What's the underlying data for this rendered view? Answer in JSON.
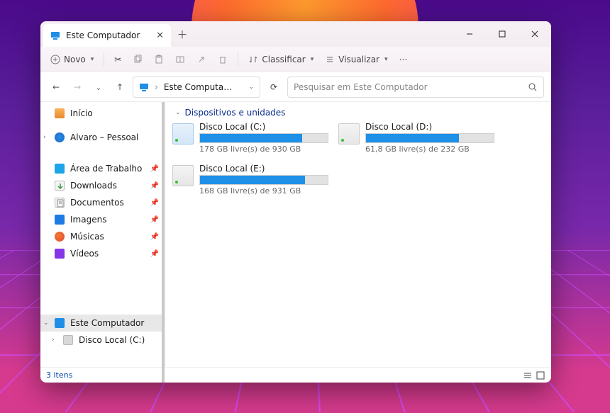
{
  "tab": {
    "title": "Este Computador"
  },
  "toolbar": {
    "new": "Novo",
    "sort": "Classificar",
    "view": "Visualizar"
  },
  "address": {
    "label": "Este Computa…"
  },
  "search": {
    "placeholder": "Pesquisar em Este Computador"
  },
  "sidebar": {
    "home": "Início",
    "personal": "Alvaro – Pessoal",
    "desktop": "Área de Trabalho",
    "downloads": "Downloads",
    "documents": "Documentos",
    "images": "Imagens",
    "music": "Músicas",
    "videos": "Vídeos",
    "thispc": "Este Computador",
    "diskc": "Disco Local (C:)"
  },
  "group": {
    "header": "Dispositivos e unidades"
  },
  "drives": [
    {
      "name": "Disco Local (C:)",
      "sub": "178 GB livre(s) de 930 GB",
      "fill": 80,
      "icon": "win"
    },
    {
      "name": "Disco Local (D:)",
      "sub": "61,8 GB livre(s) de 232 GB",
      "fill": 73,
      "icon": "hdd"
    },
    {
      "name": "Disco Local (E:)",
      "sub": "168 GB livre(s) de 931 GB",
      "fill": 82,
      "icon": "hdd"
    }
  ],
  "status": {
    "text": "3 itens"
  }
}
